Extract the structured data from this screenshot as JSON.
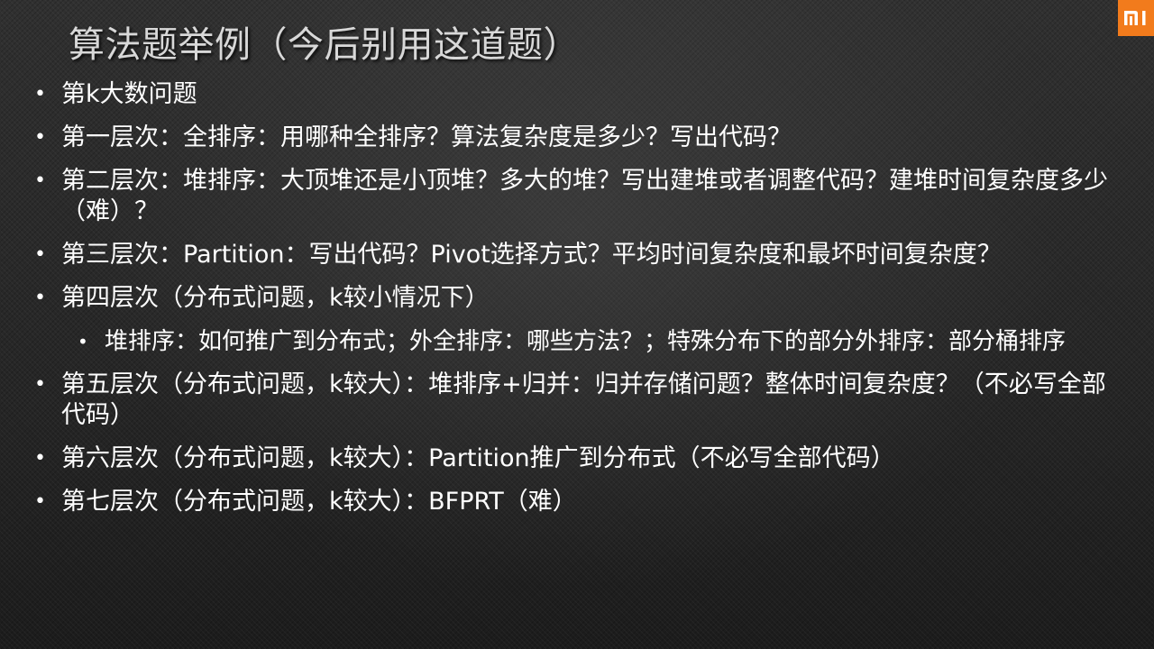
{
  "slide": {
    "title": "算法题举例（今后别用这道题）",
    "brand_color": "#f27b1c",
    "bullets": [
      {
        "level": 1,
        "text": "第k大数问题"
      },
      {
        "level": 1,
        "text": "第一层次：全排序：用哪种全排序？算法复杂度是多少？写出代码？"
      },
      {
        "level": 1,
        "text": "第二层次：堆排序：大顶堆还是小顶堆？多大的堆？写出建堆或者调整代码？建堆时间复杂度多少（难）？"
      },
      {
        "level": 1,
        "text": "第三层次：Partition：写出代码？Pivot选择方式？平均时间复杂度和最坏时间复杂度？"
      },
      {
        "level": 1,
        "text": "第四层次（分布式问题，k较小情况下）"
      },
      {
        "level": 2,
        "text": "堆排序：如何推广到分布式；外全排序：哪些方法？；特殊分布下的部分外排序：部分桶排序"
      },
      {
        "level": 1,
        "text": "第五层次（分布式问题，k较大）：堆排序+归并：归并存储问题？整体时间复杂度？（不必写全部代码）"
      },
      {
        "level": 1,
        "text": "第六层次（分布式问题，k较大）：Partition推广到分布式（不必写全部代码）"
      },
      {
        "level": 1,
        "text": "第七层次（分布式问题，k较大）：BFPRT（难）"
      }
    ]
  }
}
